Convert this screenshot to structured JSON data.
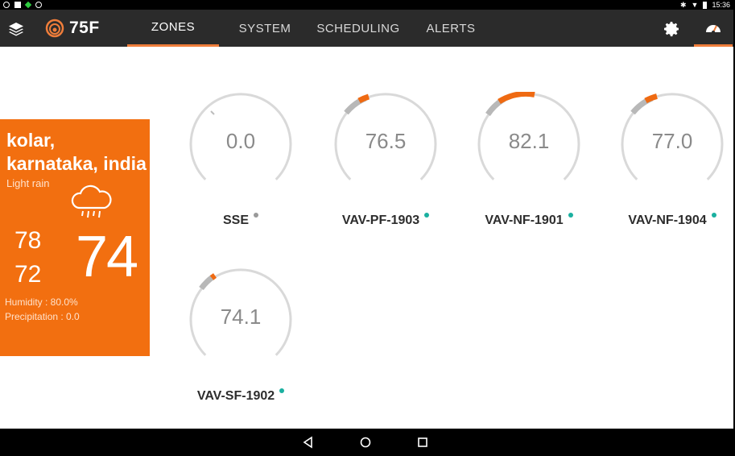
{
  "status_bar": {
    "time": "15:36"
  },
  "app": {
    "logo_text": "75F"
  },
  "tabs": [
    {
      "label": "ZONES",
      "active": true
    },
    {
      "label": "SYSTEM",
      "active": false
    },
    {
      "label": "SCHEDULING",
      "active": false
    },
    {
      "label": "ALERTS",
      "active": false
    }
  ],
  "colors": {
    "accent": "#ef7d3a",
    "weather_bg": "#f26f10",
    "appbar": "#2b2b2b",
    "status_dot": "#1ab0a0",
    "inactive_dot": "#9a9a9a"
  },
  "weather": {
    "location": "kolar, karnataka, india",
    "condition": "Light rain",
    "icon": "rain-cloud-icon",
    "high": "78",
    "low": "72",
    "current": "74",
    "humidity": "Humidity : 80.0%",
    "precipitation": "Precipitation : 0.0"
  },
  "zones": [
    {
      "name": "SSE",
      "value": "0.0",
      "status": "inactive"
    },
    {
      "name": "VAV-PF-1903",
      "value": "76.5",
      "status": "active"
    },
    {
      "name": "VAV-NF-1901",
      "value": "82.1",
      "status": "active"
    },
    {
      "name": "VAV-NF-1904",
      "value": "77.0",
      "status": "active"
    },
    {
      "name": "VAV-SF-1902",
      "value": "74.1",
      "status": "active"
    }
  ]
}
